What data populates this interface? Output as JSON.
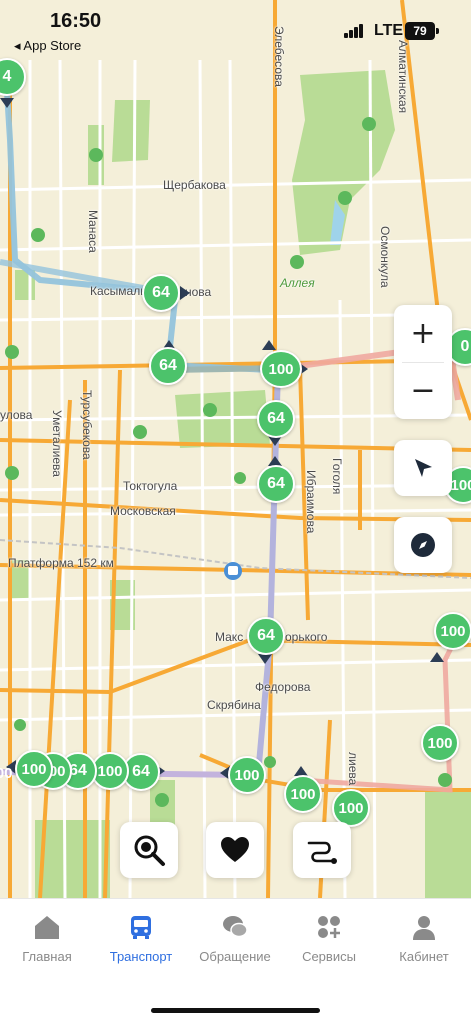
{
  "status_bar": {
    "time": "16:50",
    "back_label": "◂ App Store",
    "network": "LTE",
    "battery": "79"
  },
  "map": {
    "streets": {
      "elebesova": "Элебесова",
      "almaatinskaya": "Алматинская",
      "shcherbakova": "Щербакова",
      "manasa": "Манаса",
      "osmonkula": "Осмонкула",
      "kasymaly": "Касымалы",
      "kasymaly_tail": "нова",
      "alleya": "Аллея",
      "umetalieva": "Уметалиева",
      "tursubekova": "Турсубекова",
      "tokotogula": "Токтогула",
      "moskovskaya": "Московская",
      "ibraimova": "Ибраимова",
      "gogolya": "Гоголя",
      "platforma": "Платформа 152 км",
      "maksima": "Макс",
      "gorkogo": "орького",
      "fedorova": "Федорова",
      "skryabina": "Скрябина",
      "ulova": "улова",
      "aliyeva": "лиева"
    },
    "colors": {
      "background": "#f4efd9",
      "park": "#b9dc96",
      "major_road": "#f7a935",
      "route_blue": "#94c3dc",
      "route_lilac": "#b3b3dd",
      "route_pink": "#f0a8a0",
      "marker_green": "#4cc36b",
      "arrow_navy": "#2c3d55"
    },
    "markers": {
      "m1": "4",
      "m2": "64",
      "m3": "64",
      "m4": "100",
      "m5": "64",
      "m6": "64",
      "m7": "64",
      "m8": "100",
      "m9": "100",
      "m10": "100",
      "m11": "100",
      "m12": "64",
      "m13": "100",
      "m14": "64",
      "m15": "100",
      "m16": "100",
      "m17": "100",
      "m18": "100",
      "m19": "0",
      "m20": "100"
    }
  },
  "controls": {
    "zoom_in": "+",
    "zoom_out": "−"
  },
  "tabbar": {
    "home": "Главная",
    "transport": "Транспорт",
    "appeal": "Обращение",
    "services": "Сервисы",
    "cabinet": "Кабинет"
  }
}
